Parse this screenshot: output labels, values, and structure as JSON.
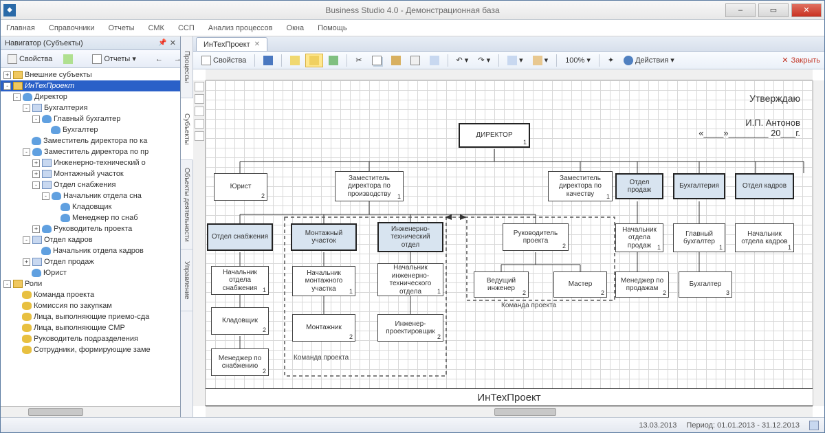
{
  "app": {
    "title": "Business Studio 4.0 - Демонстрационная база"
  },
  "menu": [
    "Главная",
    "Справочники",
    "Отчеты",
    "СМК",
    "ССП",
    "Анализ процессов",
    "Окна",
    "Помощь"
  ],
  "navigator": {
    "title": "Навигатор (Субъекты)",
    "tb": {
      "props": "Свойства",
      "reports": "Отчеты"
    }
  },
  "tree": [
    {
      "pad": 0,
      "exp": "+",
      "ico": "folder",
      "label": "Внешние субъекты"
    },
    {
      "pad": 0,
      "exp": "-",
      "ico": "folder",
      "label": "ИнТехПроект",
      "sel": true
    },
    {
      "pad": 1,
      "exp": "-",
      "ico": "person",
      "label": "Директор"
    },
    {
      "pad": 2,
      "exp": "-",
      "ico": "dept",
      "label": "Бухгалтерия"
    },
    {
      "pad": 3,
      "exp": "-",
      "ico": "person",
      "label": "Главный бухгалтер"
    },
    {
      "pad": 4,
      "exp": "",
      "ico": "person",
      "label": "Бухгалтер"
    },
    {
      "pad": 2,
      "exp": "",
      "ico": "person",
      "label": "Заместитель директора по ка"
    },
    {
      "pad": 2,
      "exp": "-",
      "ico": "person",
      "label": "Заместитель директора по пр"
    },
    {
      "pad": 3,
      "exp": "+",
      "ico": "dept",
      "label": "Инженерно-технический о"
    },
    {
      "pad": 3,
      "exp": "+",
      "ico": "dept",
      "label": "Монтажный участок"
    },
    {
      "pad": 3,
      "exp": "-",
      "ico": "dept",
      "label": "Отдел снабжения"
    },
    {
      "pad": 4,
      "exp": "-",
      "ico": "person",
      "label": "Начальник отдела сна"
    },
    {
      "pad": 5,
      "exp": "",
      "ico": "person",
      "label": "Кладовщик"
    },
    {
      "pad": 5,
      "exp": "",
      "ico": "person",
      "label": "Менеджер по снаб"
    },
    {
      "pad": 3,
      "exp": "+",
      "ico": "person",
      "label": "Руководитель проекта"
    },
    {
      "pad": 2,
      "exp": "-",
      "ico": "dept",
      "label": "Отдел кадров"
    },
    {
      "pad": 3,
      "exp": "",
      "ico": "person",
      "label": "Начальник отдела кадров"
    },
    {
      "pad": 2,
      "exp": "+",
      "ico": "dept",
      "label": "Отдел продаж"
    },
    {
      "pad": 2,
      "exp": "",
      "ico": "person",
      "label": "Юрист"
    },
    {
      "pad": 0,
      "exp": "-",
      "ico": "folder",
      "label": "Роли"
    },
    {
      "pad": 1,
      "exp": "",
      "ico": "role",
      "label": "Команда проекта"
    },
    {
      "pad": 1,
      "exp": "",
      "ico": "role",
      "label": "Комиссия по закупкам"
    },
    {
      "pad": 1,
      "exp": "",
      "ico": "role",
      "label": "Лица, выполняющие приемо-сда"
    },
    {
      "pad": 1,
      "exp": "",
      "ico": "role",
      "label": "Лица, выполняющие СМР"
    },
    {
      "pad": 1,
      "exp": "",
      "ico": "role",
      "label": "Руководитель подразделения"
    },
    {
      "pad": 1,
      "exp": "",
      "ico": "role",
      "label": "Сотрудники, формирующие заме"
    }
  ],
  "vtabs": [
    "Процессы",
    "Субъекты",
    "Объекты деятельности",
    "Управление"
  ],
  "tab": {
    "label": "ИнТехПроект"
  },
  "rtb": {
    "props": "Свойства",
    "zoom": "100%",
    "actions": "Действия",
    "close": "Закрыть"
  },
  "diagram": {
    "approve": "Утверждаю",
    "signer": "И.П. Антонов",
    "date_line": "«____»________ 20___г.",
    "team": "Команда проекта",
    "footer": "ИнТехПроект",
    "nodes": {
      "director": "ДИРЕКТОР",
      "jurist": "Юрист",
      "zam_proizv": "Заместитель директора по производству",
      "zam_kach": "Заместитель директора по качеству",
      "otdel_prodazh": "Отдел продаж",
      "buh": "Бухгалтерия",
      "otdel_kadrov": "Отдел кадров",
      "otdel_snab": "Отдел снабжения",
      "mont_uch": "Монтажный участок",
      "ito": "Инженерно-технический отдел",
      "ruk_proekta": "Руководитель проекта",
      "nach_prodazh": "Начальник отдела продаж",
      "gl_buh": "Главный бухгалтер",
      "nach_kadrov": "Начальник отдела кадров",
      "nach_snab": "Начальник отдела снабжения",
      "nach_mont": "Начальник монтажного участка",
      "nach_ito": "Начальник инженерно-технического отдела",
      "ved_ing": "Ведущий инженер",
      "master": "Мастер",
      "men_prodazh": "Менеджер по продажам",
      "buhgalter": "Бухгалтер",
      "kladov": "Кладовщик",
      "montazh": "Монтажник",
      "ing_proekt": "Инженер-проектировщик",
      "men_snab": "Менеджер по снабжению"
    }
  },
  "status": {
    "date": "13.03.2013",
    "period": "Период: 01.01.2013 - 31.12.2013"
  }
}
